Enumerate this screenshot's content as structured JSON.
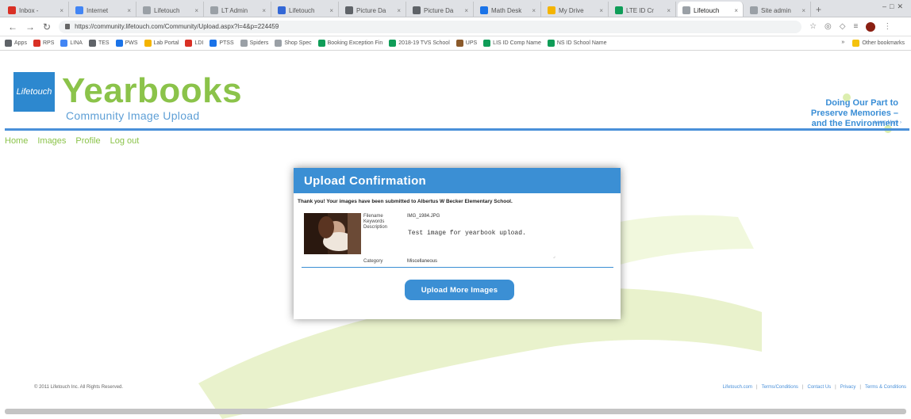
{
  "browser": {
    "tabs": [
      {
        "label": "Inbox - ",
        "color": "#d93025"
      },
      {
        "label": "Internet",
        "color": "#4285f4"
      },
      {
        "label": "Lifetouch",
        "color": "#9aa0a6"
      },
      {
        "label": "LT Admin",
        "color": "#9aa0a6"
      },
      {
        "label": "Lifetouch",
        "color": "#3367d6"
      },
      {
        "label": "Picture Da",
        "color": "#5f6368"
      },
      {
        "label": "Picture Da",
        "color": "#5f6368"
      },
      {
        "label": "Math Desk",
        "color": "#1a73e8"
      },
      {
        "label": "My Drive",
        "color": "#f4b400"
      },
      {
        "label": "LTE ID Cr",
        "color": "#0f9d58"
      },
      {
        "label": "Lifetouch",
        "color": "#9aa0a6",
        "active": true
      },
      {
        "label": "Site admin",
        "color": "#9aa0a6"
      }
    ],
    "new_tab": "+",
    "url": "https://community.lifetouch.com/Community/Upload.aspx?l=4&p=224459",
    "bookmarks": [
      {
        "label": "Apps",
        "color": "#5f6368"
      },
      {
        "label": "RPS",
        "color": "#d93025"
      },
      {
        "label": "LINA",
        "color": "#4285f4"
      },
      {
        "label": "TES",
        "color": "#5f6368"
      },
      {
        "label": "PWS",
        "color": "#1a73e8"
      },
      {
        "label": "Lab Portal",
        "color": "#f4b400"
      },
      {
        "label": "LDI",
        "color": "#d93025"
      },
      {
        "label": "PTSS",
        "color": "#1a73e8"
      },
      {
        "label": "Spiders",
        "color": "#9aa0a6"
      },
      {
        "label": "Shop Spec",
        "color": "#9aa0a6"
      },
      {
        "label": "Booking Exception Fin",
        "color": "#0f9d58"
      },
      {
        "label": "2018-19 TVS School",
        "color": "#0f9d58"
      },
      {
        "label": "UPS",
        "color": "#8b5a2b"
      },
      {
        "label": "LIS ID Comp Name",
        "color": "#0f9d58"
      },
      {
        "label": "NS ID School Name",
        "color": "#0f9d58"
      }
    ],
    "other_bookmarks": "Other bookmarks"
  },
  "header": {
    "logo_text": "Lifetouch",
    "brand": "Yearbooks",
    "tagline": "Community Image Upload",
    "promo_lines": [
      "Doing Our Part to",
      "Preserve Memories –",
      "and the Environment"
    ],
    "learn_more": "Learn More ›"
  },
  "nav": {
    "items": [
      "Home",
      "Images",
      "Profile",
      "Log out"
    ]
  },
  "modal": {
    "title": "Upload Confirmation",
    "message": "Thank you! Your images have been submitted to Albertus W Becker Elementary School.",
    "labels": {
      "filename": "Filename",
      "keywords": "Keywords",
      "description": "Description",
      "category": "Category"
    },
    "filename": "IMG_1984.JPG",
    "description": "Test image for yearbook upload.",
    "category": "Miscellaneous",
    "button": "Upload More Images"
  },
  "footer": {
    "copyright": "© 2011 Lifetouch Inc. All Rights Reserved.",
    "links": [
      "Lifetouch.com",
      "Terms/Conditions",
      "Contact Us",
      "Privacy",
      "Terms & Conditions"
    ]
  }
}
